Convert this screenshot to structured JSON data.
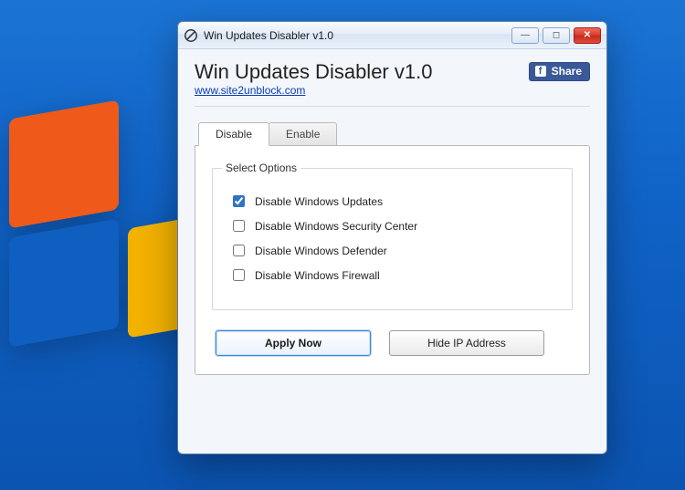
{
  "window": {
    "title": "Win Updates Disabler v1.0"
  },
  "header": {
    "app_title": "Win Updates Disabler v1.0",
    "site_link": "www.site2unblock.com",
    "share_label": "Share"
  },
  "tabs": {
    "disable": "Disable",
    "enable": "Enable"
  },
  "group": {
    "legend": "Select Options",
    "options": [
      {
        "label": "Disable Windows Updates",
        "checked": true
      },
      {
        "label": "Disable Windows Security Center",
        "checked": false
      },
      {
        "label": "Disable Windows Defender",
        "checked": false
      },
      {
        "label": "Disable Windows Firewall",
        "checked": false
      }
    ]
  },
  "buttons": {
    "apply": "Apply Now",
    "hide_ip": "Hide IP Address"
  }
}
